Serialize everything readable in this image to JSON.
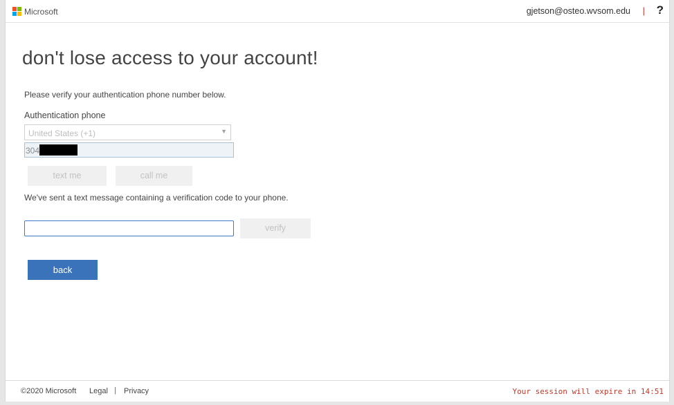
{
  "header": {
    "brand": "Microsoft",
    "user_email": "gjetson@osteo.wvsom.edu",
    "divider": "|",
    "help_label": "?"
  },
  "main": {
    "headline": "don't lose access to your account!",
    "instruction": "Please verify your authentication phone number below.",
    "phone_label": "Authentication phone",
    "country_value": "United States (+1)",
    "phone_prefix": "304",
    "text_me_label": "text me",
    "call_me_label": "call me",
    "sent_message": "We've sent a text message containing a verification code to your phone.",
    "code_value": "",
    "verify_label": "verify",
    "back_label": "back"
  },
  "footer": {
    "copyright": "©2020 Microsoft",
    "legal": "Legal",
    "separator": "|",
    "privacy": "Privacy",
    "session_text": "Your session will expire in 14:51"
  },
  "colors": {
    "accent": "#3b73ba",
    "warning": "#c0392b",
    "ms_red": "#f25022",
    "ms_green": "#7fba00",
    "ms_blue": "#00a4ef",
    "ms_yellow": "#ffb900"
  }
}
